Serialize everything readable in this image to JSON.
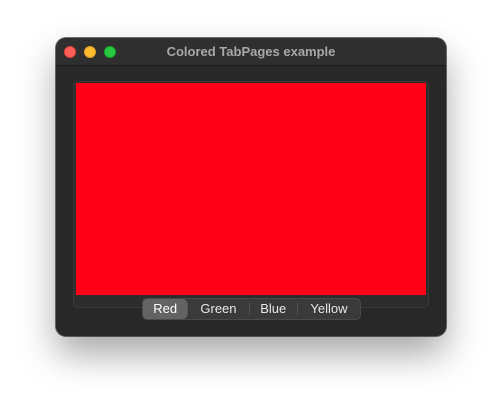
{
  "window": {
    "title": "Colored TabPages example"
  },
  "tabs": [
    {
      "label": "Red",
      "color": "#ff0016"
    },
    {
      "label": "Green",
      "color": "#00c800"
    },
    {
      "label": "Blue",
      "color": "#0000ff"
    },
    {
      "label": "Yellow",
      "color": "#ffff00"
    }
  ],
  "selected_tab": 0,
  "colors": {
    "close": "#fe5f57",
    "minimize": "#febc2e",
    "zoom": "#28c840"
  }
}
